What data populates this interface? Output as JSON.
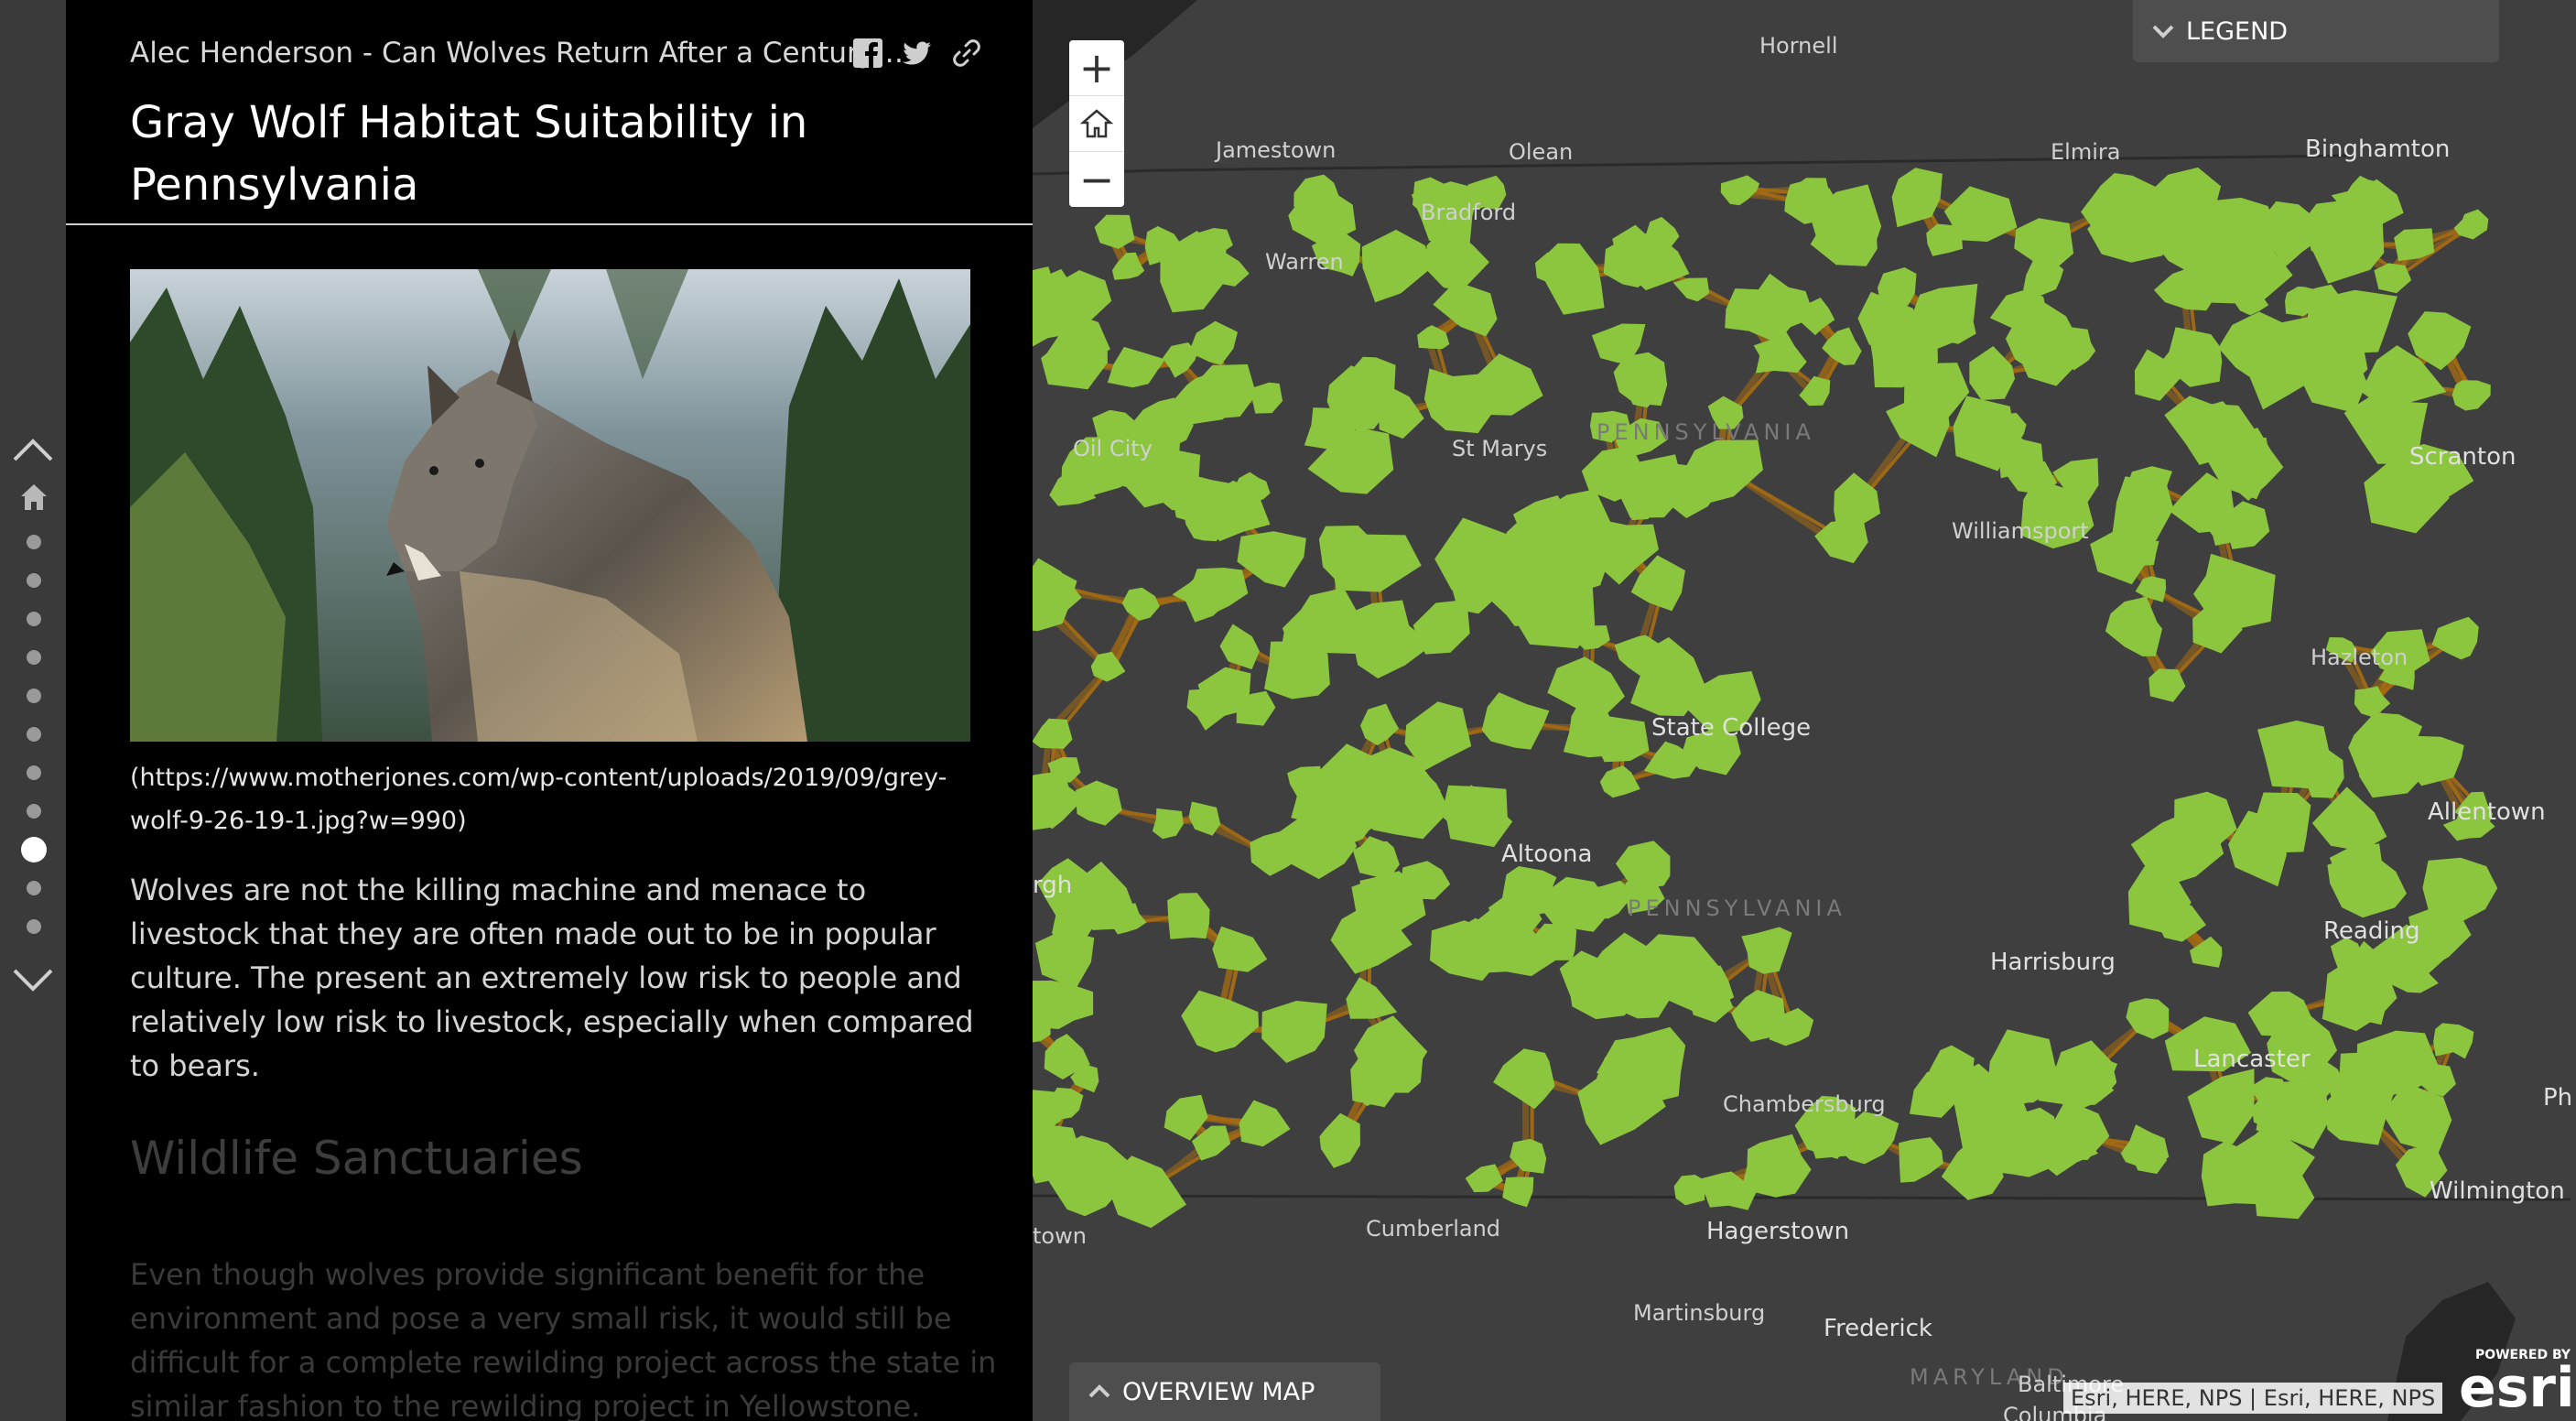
{
  "story": {
    "byline": "Alec Henderson - Can Wolves Return After a Century o...",
    "title": "Gray Wolf Habitat Suitability in Pennsylvania",
    "image_caption": "(https://www.motherjones.com/wp-content/uploads/2019/09/grey-wolf-9-26-19-1.jpg?w=990)",
    "paragraph1": "Wolves are not the killing machine and menace to livestock that they are often made out to be in popular culture. The present an extremely low risk to people and relatively low risk to livestock, especially when compared to bears.",
    "section_heading": "Wildlife Sanctuaries",
    "paragraph2": "Even though wolves provide significant benefit for the environment and pose a very small risk, it would still be difficult for a complete rewilding project across the state in similar fashion to the rewilding project in Yellowstone. Even if"
  },
  "share_icons": [
    "facebook-icon",
    "twitter-icon",
    "link-icon"
  ],
  "nav": {
    "section_count": 11,
    "active_section": 8
  },
  "map": {
    "zoom_in": "+",
    "zoom_out": "−",
    "legend_label": "LEGEND",
    "overview_label": "OVERVIEW MAP",
    "attribution": "Esri, HERE, NPS | Esri, HERE, NPS",
    "powered_by": "POWERED BY",
    "esri_logo": "esri",
    "cities": {
      "hornell": "Hornell",
      "jamestown": "Jamestown",
      "olean": "Olean",
      "elmira": "Elmira",
      "binghamton": "Binghamton",
      "bradford": "Bradford",
      "warren": "Warren",
      "oil_city": "Oil City",
      "st_marys": "St Marys",
      "pennsylvania_1": "PENNSYLVANIA",
      "scranton": "Scranton",
      "williamsport": "Williamsport",
      "hazleton": "Hazleton",
      "state_college": "State College",
      "allentown": "Allentown",
      "altoona": "Altoona",
      "pittsburgh": "rgh",
      "pennsylvania_2": "PENNSYLVANIA",
      "reading": "Reading",
      "harrisburg": "Harrisburg",
      "lancaster": "Lancaster",
      "chambersburg": "Chambersburg",
      "philadelphia": "Ph",
      "wilmington": "Wilmington",
      "morgantown": "town",
      "cumberland": "Cumberland",
      "hagerstown": "Hagerstown",
      "martinsburg": "Martinsburg",
      "frederick": "Frederick",
      "maryland": "MARYLAND",
      "baltimore": "Baltimore",
      "columbia": "Columbia"
    },
    "colors": {
      "habitat": "#8cc63f",
      "corridor": "#a26a14",
      "basemap": "#3f3f3f"
    }
  }
}
